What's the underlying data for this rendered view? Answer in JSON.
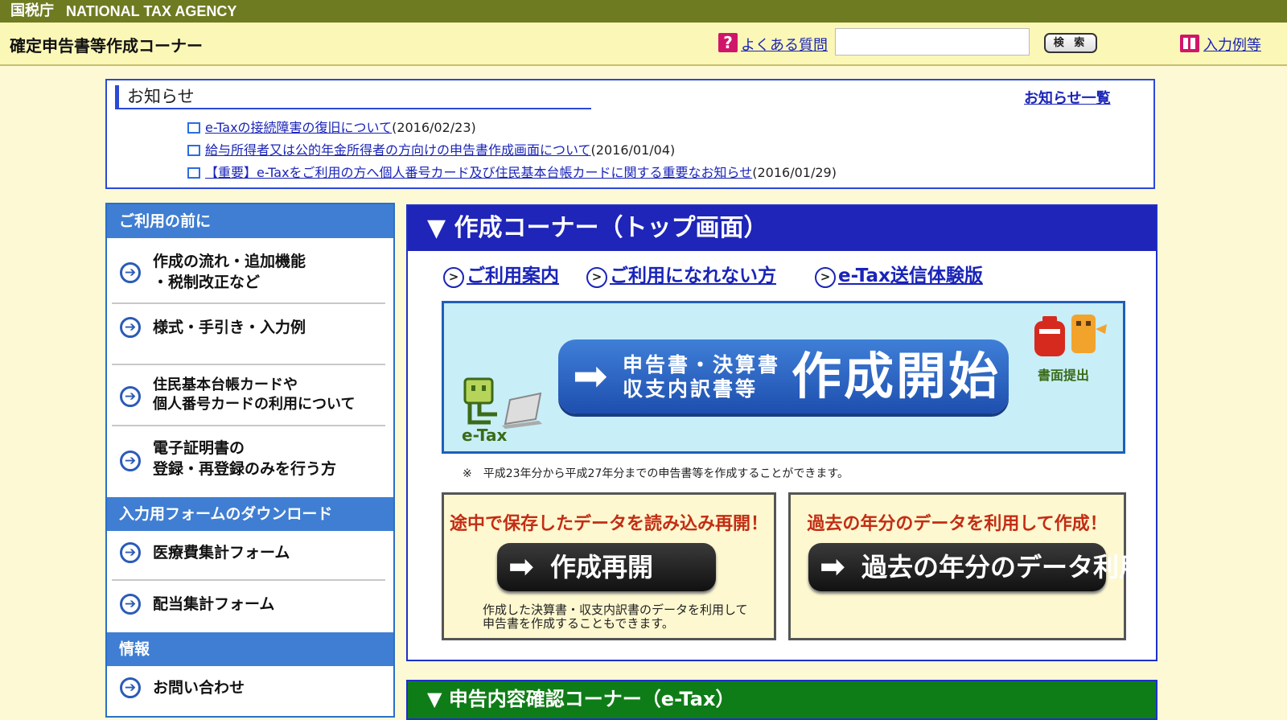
{
  "topbar": {
    "agency_ja": "国税庁",
    "agency_en": "NATIONAL TAX AGENCY"
  },
  "header": {
    "title": "確定申告書等作成コーナー",
    "faq_label": "よくある質問",
    "search_button": "検 索",
    "search_value": "",
    "example_label": "入力例等"
  },
  "notice": {
    "heading": "お知らせ",
    "all_link": "お知らせ一覧",
    "items": [
      {
        "text": "e-Taxの接続障害の復旧について",
        "date": "(2016/02/23)"
      },
      {
        "text": "給与所得者又は公的年金所得者の方向けの申告書作成画面について",
        "date": "(2016/01/04)"
      },
      {
        "text": "【重要】e-Taxをご利用の方へ個人番号カード及び住民基本台帳カードに関する重要なお知らせ",
        "date": "(2016/01/29)"
      }
    ]
  },
  "sidebar": {
    "sections": [
      {
        "title": "ご利用の前に"
      },
      {
        "title": "入力用フォームのダウンロード"
      },
      {
        "title": "情報"
      }
    ],
    "items": [
      {
        "line1": "作成の流れ・追加機能",
        "line2": "・税制改正など"
      },
      {
        "line1": "様式・手引き・入力例",
        "line2": ""
      },
      {
        "line1": "住民基本台帳カードや",
        "line2": "個人番号カードの利用について"
      },
      {
        "line1": "電子証明書の",
        "line2": "登録・再登録のみを行う方"
      },
      {
        "line1": "医療費集計フォーム",
        "line2": ""
      },
      {
        "line1": "配当集計フォーム",
        "line2": ""
      },
      {
        "line1": "お問い合わせ",
        "line2": ""
      }
    ]
  },
  "main": {
    "heading": "▼ 作成コーナー（トップ画面）",
    "links": [
      "ご利用案内",
      "ご利用になれない方",
      "e-Tax送信体験版"
    ],
    "start_small_1": "申告書・決算書",
    "start_small_2": "収支内訳書等",
    "start_big": "作成開始",
    "etax_label": "e-Tax",
    "paper_label": "書面提出",
    "note": "※　平成23年分から平成27年分までの申告書等を作成することができます。",
    "resume": {
      "caption": "途中で保存したデータを読み込み再開！",
      "button": "作成再開",
      "desc_1": "作成した決算書・収支内訳書のデータを利用して",
      "desc_2": "申告書を作成することもできます。"
    },
    "past": {
      "caption": "過去の年分のデータを利用して作成！",
      "button": "過去の年分のデータ利用"
    }
  },
  "confirm": {
    "heading": "▼ 申告内容確認コーナー（e-Tax）"
  },
  "icons": {
    "faq": "question-icon",
    "example": "book-icon",
    "doc": "document-icon",
    "nav": "arrow-right-circle-icon"
  },
  "colors": {
    "topbar": "#6e7b21",
    "header": "#fbf7b7",
    "main_blue": "#1e25b8",
    "sidebar_blue": "#3f7ed2",
    "confirm_green": "#0f7d17",
    "caption_red": "#c32d14"
  }
}
